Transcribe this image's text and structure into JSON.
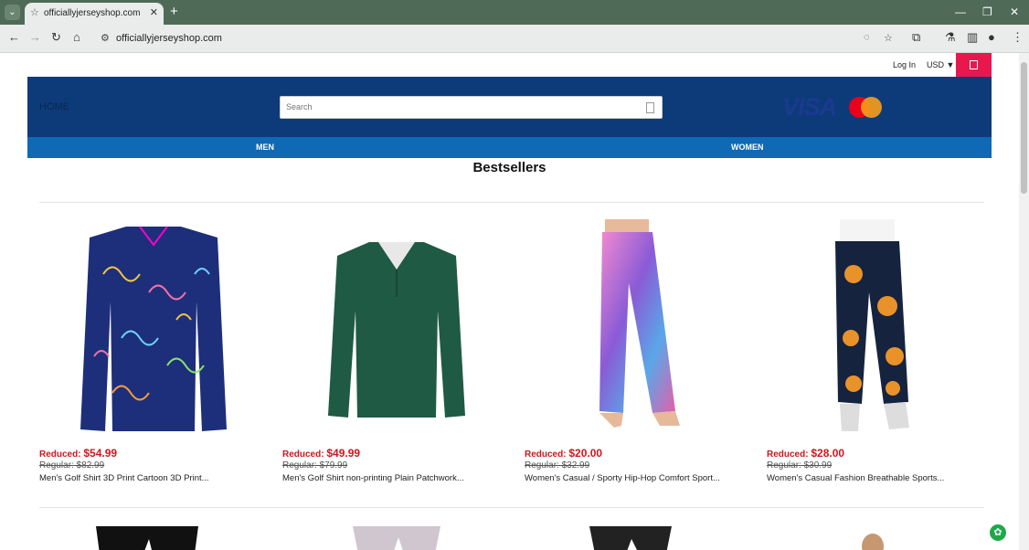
{
  "browser": {
    "tab_title": "officiallyjerseyshop.com",
    "url": "officiallyjerseyshop.com"
  },
  "topbar": {
    "login": "Log In",
    "currency": "USD"
  },
  "header": {
    "home": "HOME",
    "search_placeholder": "Search",
    "visa": "VISA"
  },
  "nav": {
    "men": "MEN",
    "women": "WOMEN"
  },
  "section_title": "Bestsellers",
  "products": [
    {
      "reduced_label": "Reduced:",
      "price": "$54.99",
      "regular": "Regular: $82.99",
      "name": "Men's Golf Shirt 3D Print Cartoon 3D Print..."
    },
    {
      "reduced_label": "Reduced:",
      "price": "$49.99",
      "regular": "Regular: $79.99",
      "name": "Men's Golf Shirt non-printing Plain Patchwork..."
    },
    {
      "reduced_label": "Reduced:",
      "price": "$20.00",
      "regular": "Regular: $32.99",
      "name": "Women's Casual / Sporty Hip-Hop Comfort Sport..."
    },
    {
      "reduced_label": "Reduced:",
      "price": "$28.00",
      "regular": "Regular: $30.99",
      "name": "Women's Casual Fashion Breathable Sports..."
    }
  ],
  "colors": {
    "header_bg": "#0d3b7a",
    "nav_bg": "#0f69b4",
    "cart_bg": "#e8184e",
    "price_red": "#d0161c"
  }
}
